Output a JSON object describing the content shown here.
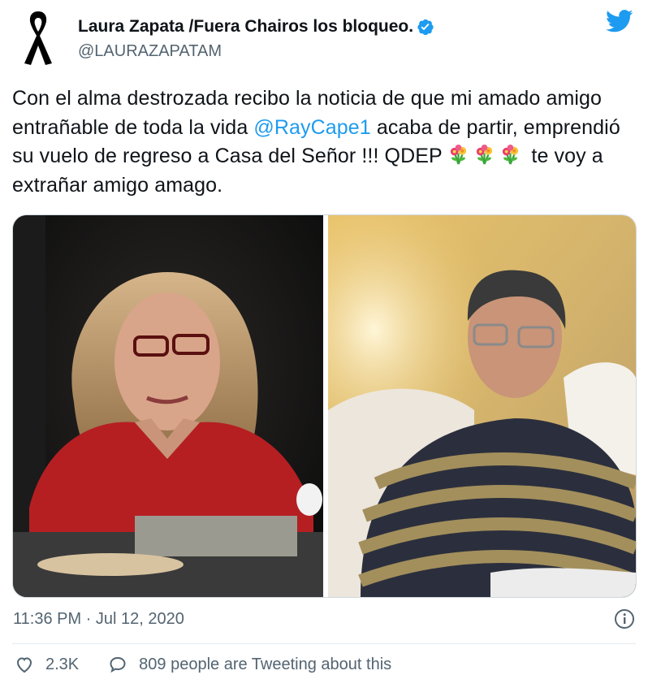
{
  "tweet": {
    "display_name": "Laura Zapata /Fuera Chairos los bloqueo.",
    "handle": "@LAURAZAPATAM",
    "text_before_mention": "Con el alma destrozada recibo la noticia de que mi amado amigo entrañable de toda la vida ",
    "mention": "@RayCape1",
    "text_after_mention": " acaba de partir, emprendió  su vuelo de regreso a Casa del Señor !!! QDEP ",
    "text_after_emoji": " te voy a extrañar amigo amago.",
    "emoji": [
      "bouquet-emoji",
      "bouquet-emoji",
      "bouquet-emoji"
    ],
    "timestamp": "11:36 PM · Jul 12, 2020",
    "likes": "2.3K",
    "tweeting_about": "809 people are Tweeting about this"
  },
  "icons": {
    "avatar": "black-mourning-ribbon",
    "verified": "verified-badge-icon",
    "brand": "twitter-bird-icon",
    "info": "info-icon",
    "like": "heart-icon",
    "reply": "speech-bubble-icon"
  },
  "colors": {
    "accent": "#1d9bf0",
    "text": "#0f1419",
    "muted": "#536471",
    "border": "#cfd9de"
  }
}
